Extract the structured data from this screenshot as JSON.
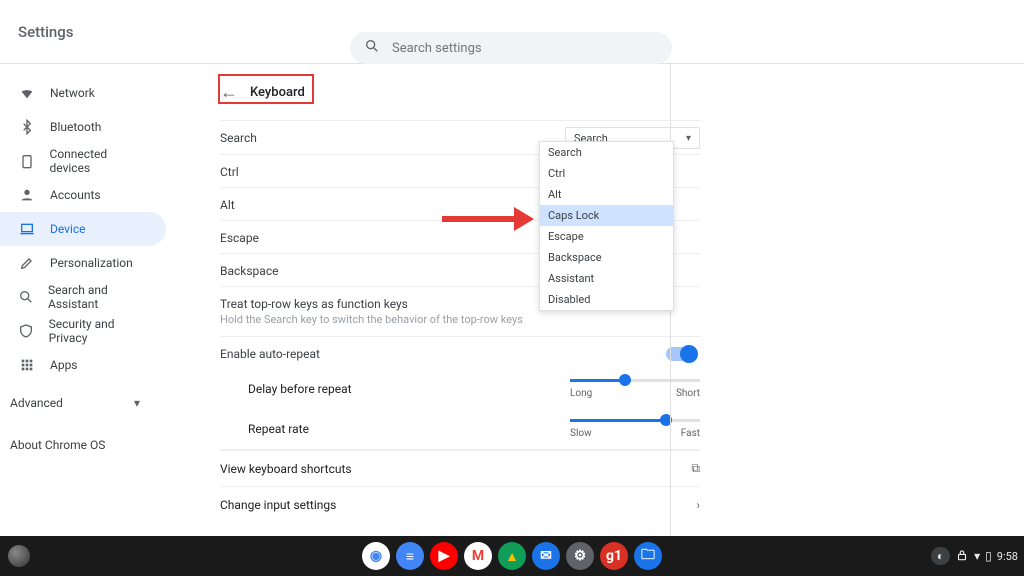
{
  "window": {
    "minimize": "—",
    "restore": "❐",
    "close": "✕"
  },
  "header": {
    "title": "Settings",
    "search_placeholder": "Search settings"
  },
  "sidebar": {
    "items": [
      {
        "id": "network",
        "label": "Network"
      },
      {
        "id": "bluetooth",
        "label": "Bluetooth"
      },
      {
        "id": "connected-devices",
        "label": "Connected devices"
      },
      {
        "id": "accounts",
        "label": "Accounts"
      },
      {
        "id": "device",
        "label": "Device",
        "selected": true
      },
      {
        "id": "personalization",
        "label": "Personalization"
      },
      {
        "id": "search-assistant",
        "label": "Search and Assistant"
      },
      {
        "id": "security-privacy",
        "label": "Security and Privacy"
      },
      {
        "id": "apps",
        "label": "Apps"
      }
    ],
    "advanced": "Advanced",
    "about": "About Chrome OS"
  },
  "page": {
    "title": "Keyboard",
    "rows": {
      "search": "Search",
      "ctrl": "Ctrl",
      "alt": "Alt",
      "escape": "Escape",
      "backspace": "Backspace",
      "toprow": {
        "label": "Treat top-row keys as function keys",
        "sub": "Hold the Search key to switch the behavior of the top-row keys"
      },
      "autorepeat": "Enable auto-repeat"
    },
    "search_select": {
      "value": "Search",
      "options": [
        "Search",
        "Ctrl",
        "Alt",
        "Caps Lock",
        "Escape",
        "Backspace",
        "Assistant",
        "Disabled"
      ],
      "highlighted": "Caps Lock"
    },
    "sliders": {
      "delay": {
        "label": "Delay before repeat",
        "left": "Long",
        "right": "Short",
        "value_pct": 42
      },
      "rate": {
        "label": "Repeat rate",
        "left": "Slow",
        "right": "Fast",
        "value_pct": 74
      }
    },
    "links": {
      "shortcuts": "View keyboard shortcuts",
      "input": "Change input settings"
    }
  },
  "shelf": {
    "apps": [
      {
        "id": "chrome",
        "bg": "#fff",
        "fg": "#4285f4",
        "glyph": "◉"
      },
      {
        "id": "docs",
        "bg": "#4285f4",
        "fg": "#fff",
        "glyph": "≡"
      },
      {
        "id": "youtube",
        "bg": "#ff0000",
        "fg": "#fff",
        "glyph": "▶"
      },
      {
        "id": "gmail",
        "bg": "#fff",
        "fg": "#ea4335",
        "glyph": "M"
      },
      {
        "id": "drive",
        "bg": "#0f9d58",
        "fg": "#fbbc04",
        "glyph": "▲"
      },
      {
        "id": "messages",
        "bg": "#1a73e8",
        "fg": "#fff",
        "glyph": "✉"
      },
      {
        "id": "settings",
        "bg": "#5f6368",
        "fg": "#fff",
        "glyph": "⚙"
      },
      {
        "id": "g1",
        "bg": "#d93025",
        "fg": "#fff",
        "glyph": "g1"
      },
      {
        "id": "files",
        "bg": "#1a73e8",
        "fg": "#fff",
        "glyph": "🗀"
      }
    ],
    "status": {
      "time": "9:58",
      "battery_shape": "▯"
    }
  }
}
